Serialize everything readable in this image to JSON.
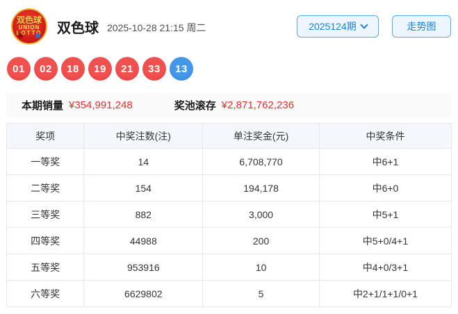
{
  "header": {
    "logo": {
      "line1": "双色球",
      "line2": "UNION",
      "line3": "LOTTO"
    },
    "title": "双色球",
    "datetime": "2025-10-28 21:15 周二",
    "period_selector": "2025124期",
    "trend_button": "走势图"
  },
  "balls": [
    {
      "value": "01",
      "type": "red"
    },
    {
      "value": "02",
      "type": "red"
    },
    {
      "value": "18",
      "type": "red"
    },
    {
      "value": "19",
      "type": "red"
    },
    {
      "value": "21",
      "type": "red"
    },
    {
      "value": "33",
      "type": "red"
    },
    {
      "value": "13",
      "type": "blue"
    }
  ],
  "summary": {
    "sales_label": "本期销量",
    "sales_value": "¥354,991,248",
    "pool_label": "奖池滚存",
    "pool_value": "¥2,871,762,236"
  },
  "table": {
    "headers": [
      "奖项",
      "中奖注数(注)",
      "单注奖金(元)",
      "中奖条件"
    ],
    "col_widths": [
      "17.4%",
      "26.7%",
      "26.2%",
      "29.7%"
    ],
    "rows": [
      [
        "一等奖",
        "14",
        "6,708,770",
        "中6+1"
      ],
      [
        "二等奖",
        "154",
        "194,178",
        "中6+0"
      ],
      [
        "三等奖",
        "882",
        "3,000",
        "中5+1"
      ],
      [
        "四等奖",
        "44988",
        "200",
        "中5+0/4+1"
      ],
      [
        "五等奖",
        "953916",
        "10",
        "中4+0/3+1"
      ],
      [
        "六等奖",
        "6629802",
        "5",
        "中2+1/1+1/0+1"
      ]
    ]
  },
  "colors": {
    "ball_red": "#f0504e",
    "ball_red_dark": "#e33c3a",
    "ball_blue": "#4496e9",
    "ball_blue_dark": "#3485da",
    "value_red": "#ee2c2c",
    "button_blue": "#1a82d9"
  }
}
